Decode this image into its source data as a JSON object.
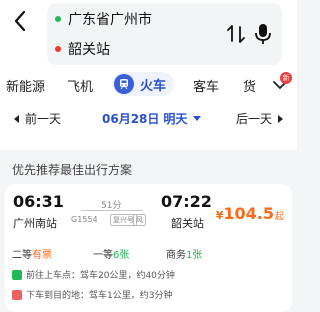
{
  "route": {
    "from": "广东省广州市",
    "to": "韶关站"
  },
  "tabs": [
    {
      "label": "新能源"
    },
    {
      "label": "飞机"
    },
    {
      "label": "火车"
    },
    {
      "label": "客车"
    },
    {
      "label": "货"
    }
  ],
  "new_badge": "新",
  "date_bar": {
    "prev": "前一天",
    "date": "06月28日",
    "day": "明天",
    "next": "后一天"
  },
  "section_title": "优先推荐最佳出行方案",
  "trip": {
    "dep_time": "06:31",
    "dep_station": "广州南站",
    "duration": "51分",
    "train_no": "G1554",
    "tag_a": "复兴号",
    "tag_b": "风",
    "arr_time": "07:22",
    "arr_station": "韶关站",
    "price_currency": "¥",
    "price": "104.5",
    "price_suffix": "起",
    "seats": [
      {
        "name": "二等",
        "status": "有票"
      },
      {
        "name": "一等",
        "status": "6张"
      },
      {
        "name": "商务",
        "status": "1张"
      }
    ],
    "info": [
      {
        "text": "前往上车点：驾车20公里，约40分钟"
      },
      {
        "text": "下车到目的地：驾车1公里，约3分钟"
      }
    ]
  },
  "colors": {
    "accent_blue": "#2a4fd0",
    "price_orange": "#ff6a1a",
    "ok_green": "#22b85c",
    "alert_red": "#f03838"
  }
}
